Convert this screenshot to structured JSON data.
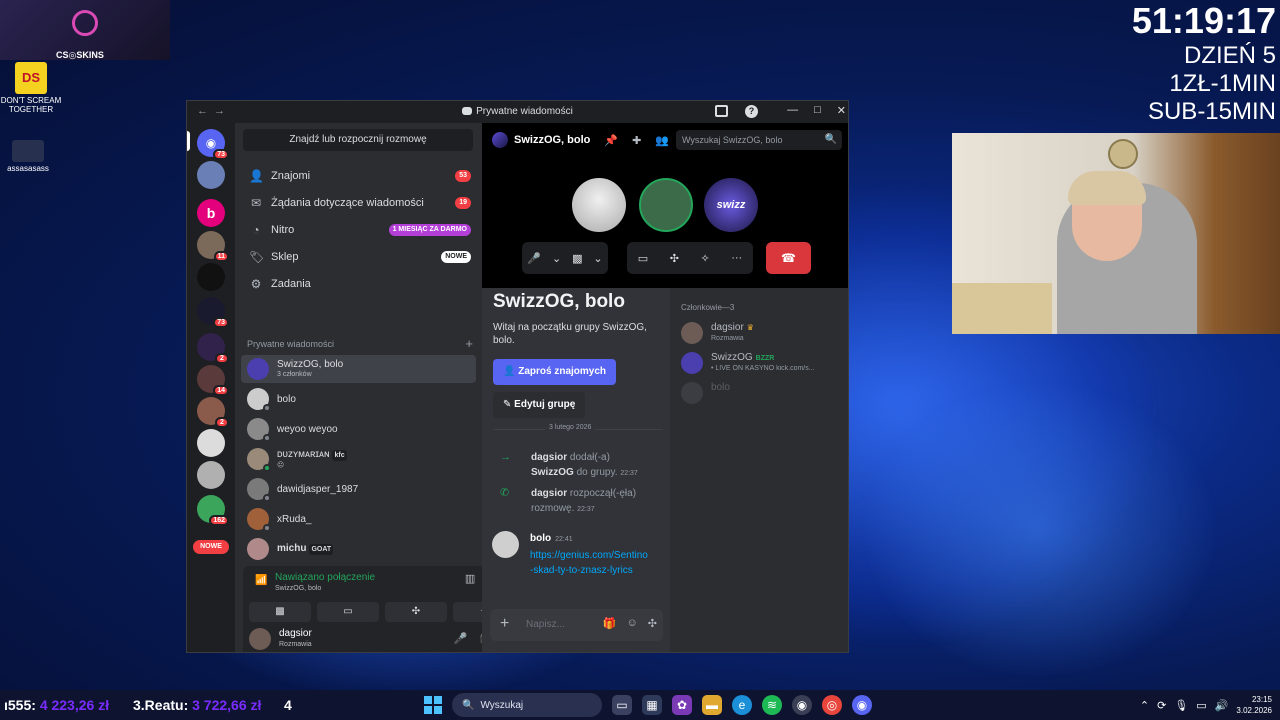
{
  "desktop": {
    "stream_logo": "CS◎SKINS",
    "icons": [
      {
        "label": "DON'T SCREAM TOGETHER",
        "image_text": "DS"
      },
      {
        "label": "assasasass"
      }
    ]
  },
  "overlay": {
    "timer": "51:19:17",
    "day": "DZIEŃ 5",
    "rate1": "1ZŁ-1MIN",
    "rate2": "SUB-15MIN"
  },
  "window": {
    "title": "Prywatne wiadomości",
    "controls": [
      "—",
      "□",
      "✕"
    ],
    "help": "?"
  },
  "servers": [
    {
      "name": "direct-messages",
      "badge": "73",
      "color": "#5865f2"
    },
    {
      "name": "server-2",
      "badge": "",
      "color": "#6a7fb5"
    },
    {
      "name": "server-3",
      "badge": "",
      "color": "#e4007c"
    },
    {
      "name": "server-4",
      "badge": "11",
      "color": "#7b6a5a"
    },
    {
      "name": "server-5",
      "badge": "",
      "color": "#111111"
    },
    {
      "name": "server-6",
      "badge": "73",
      "color": "#1a1a2e"
    },
    {
      "name": "server-7",
      "badge": "2",
      "color": "#30224a"
    },
    {
      "name": "server-8",
      "badge": "14",
      "color": "#5a3a3a"
    },
    {
      "name": "server-9",
      "badge": "2",
      "color": "#8a5a4a"
    },
    {
      "name": "server-10",
      "badge": "",
      "color": "#dcdcdc"
    },
    {
      "name": "server-11",
      "badge": "",
      "color": "#b0b0b0"
    },
    {
      "name": "server-12",
      "badge": "162",
      "color": "#3ba55c"
    }
  ],
  "new_label": "NOWE",
  "sidebar": {
    "find_button": "Znajdź lub rozpocznij rozmowę",
    "nav": [
      {
        "label": "Znajomi",
        "badge": "53",
        "icon": "friends-icon"
      },
      {
        "label": "Żądania dotyczące wiadomości",
        "badge": "19",
        "icon": "mail-icon"
      },
      {
        "label": "Nitro",
        "badge": "1 MIESIĄC ZA DARMO",
        "icon": "nitro-icon"
      },
      {
        "label": "Sklep",
        "badge": "NOWE",
        "icon": "shop-icon"
      },
      {
        "label": "Zadania",
        "badge": "",
        "icon": "quests-icon"
      }
    ],
    "dm_header": "Prywatne wiadomości",
    "dms": [
      {
        "name": "SwizzOG, bolo",
        "sub": "3 członków",
        "color": "#4b3fb0"
      },
      {
        "name": "bolo",
        "sub": "",
        "color": "#cccccc"
      },
      {
        "name": "weyoo weyoo",
        "sub": "",
        "color": "#8a8a8a"
      },
      {
        "name": "ᴅᴜᴢʏᴍᴀʀɪᴀɴ",
        "sub": "😐",
        "tag": "kfc",
        "color": "#9a8a7a"
      },
      {
        "name": "dawidjasper_1987",
        "sub": "",
        "color": "#7a7a7a"
      },
      {
        "name": "xRuda_",
        "sub": "",
        "color": "#a0603a"
      },
      {
        "name": "michu",
        "sub": "",
        "tag": "GOAT",
        "color": "#b08a8a"
      }
    ],
    "voice": {
      "status": "Nawiązano połączenie",
      "channel": "SwizzOG, bolo"
    },
    "user": {
      "name": "dagsior",
      "status": "Rozmawia"
    }
  },
  "chat": {
    "title": "SwizzOG, bolo",
    "search_placeholder": "Wyszukaj SwizzOG, bolo",
    "welcome_title": "SwizzOG, bolo",
    "welcome_text": "Witaj na początku grupy SwizzOG, bolo.",
    "invite_button": "Zaproś znajomych",
    "edit_button": "Edytuj grupę",
    "date": "3 lutego 2026",
    "system_messages": [
      {
        "author": "dagsior",
        "text1": "dodał(-a)",
        "target": "SwizzOG",
        "text2": "do grupy.",
        "time": "22:37"
      },
      {
        "author": "dagsior",
        "text1": "rozpoczął(-ęła) rozmowę.",
        "time": "22:37"
      }
    ],
    "message": {
      "author": "bolo",
      "time": "22:41",
      "link": "https://genius.com/Sentino-skad-ty-to-znasz-lyrics"
    },
    "composer_placeholder": "Napisz..."
  },
  "members": {
    "header": "Członkowie—3",
    "list": [
      {
        "name": "dagsior",
        "sub": "Rozmawia",
        "color": "#6d5b55"
      },
      {
        "name": "SwizzOG",
        "tag": "BZZR",
        "sub": "• LIVE ON KASYNO kick.com/s...",
        "color": "#4b3fb0"
      },
      {
        "name": "bolo",
        "sub": "",
        "color": "#5a5c62"
      }
    ]
  },
  "call": {
    "avatars": [
      {
        "name": "bolo",
        "color": "#d8d8d8"
      },
      {
        "name": "dagsior",
        "color": "#3c6b4a"
      },
      {
        "name": "SwizzOG",
        "color": "#4b3fb0",
        "text": "swizz"
      }
    ]
  },
  "taskbar": {
    "donations": [
      {
        "rank": "ı555:",
        "amount": "4 223,26 zł"
      },
      {
        "rank": "3.Reatu:",
        "amount": "3 722,66 zł"
      },
      {
        "rank": "4",
        "amount": ""
      }
    ],
    "search_label": "Wyszukaj",
    "time": "23:15",
    "date": "3.02.2026"
  }
}
